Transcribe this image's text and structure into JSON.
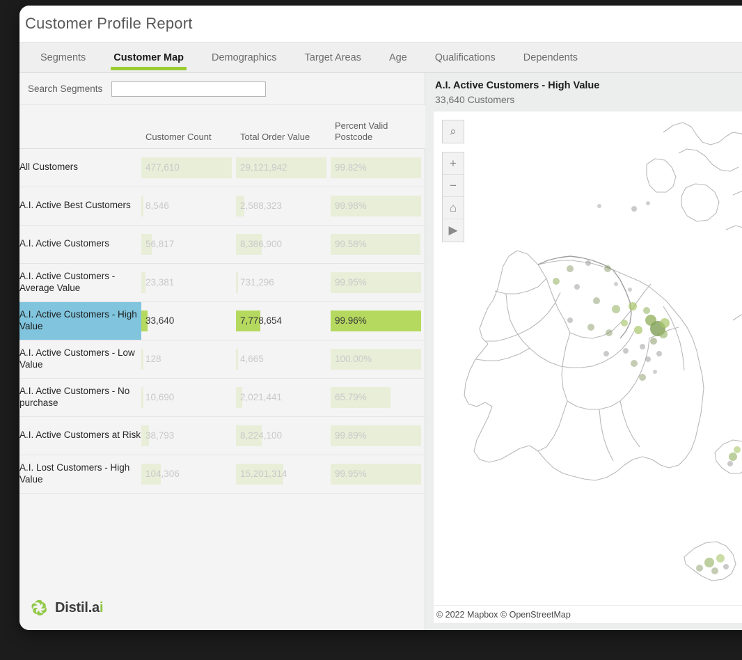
{
  "window": {
    "title": "Customer Profile Report",
    "background_color": "#1c1c1c",
    "card_color": "#f4f4f4"
  },
  "tabs": [
    {
      "label": "Segments",
      "active": false
    },
    {
      "label": "Customer Map",
      "active": true
    },
    {
      "label": "Demographics",
      "active": false
    },
    {
      "label": "Target Areas",
      "active": false
    },
    {
      "label": "Age",
      "active": false
    },
    {
      "label": "Qualifications",
      "active": false
    },
    {
      "label": "Dependents",
      "active": false
    }
  ],
  "search": {
    "label": "Search Segments",
    "value": "",
    "placeholder": ""
  },
  "table": {
    "columns": [
      "",
      "Customer Count",
      "Total Order Value",
      "Percent Valid Postcode"
    ],
    "rows": [
      {
        "name": "All Customers",
        "customer_count": "477,610",
        "total_order_value": "29,121,942",
        "percent_valid_postcode": "99.82%",
        "count_pct": 100,
        "value_pct": 100,
        "postcode_pct": 99.82,
        "selected": false
      },
      {
        "name": "A.I. Active Best Customers",
        "customer_count": "8,546",
        "total_order_value": "2,588,323",
        "percent_valid_postcode": "99.98%",
        "count_pct": 1.8,
        "value_pct": 8.9,
        "postcode_pct": 99.98,
        "selected": false
      },
      {
        "name": "A.I. Active Customers",
        "customer_count": "56,817",
        "total_order_value": "8,386,900",
        "percent_valid_postcode": "99.58%",
        "count_pct": 11.9,
        "value_pct": 28.8,
        "postcode_pct": 99.58,
        "selected": false
      },
      {
        "name": "A.I. Active Customers - Average Value",
        "customer_count": "23,381",
        "total_order_value": "731,296",
        "percent_valid_postcode": "99.95%",
        "count_pct": 4.9,
        "value_pct": 2.5,
        "postcode_pct": 99.95,
        "selected": false
      },
      {
        "name": "A.I. Active Customers - High Value",
        "customer_count": "33,640",
        "total_order_value": "7,778,654",
        "percent_valid_postcode": "99.96%",
        "count_pct": 7.0,
        "value_pct": 26.7,
        "postcode_pct": 99.96,
        "selected": true
      },
      {
        "name": "A.I. Active Customers - Low Value",
        "customer_count": "128",
        "total_order_value": "4,665",
        "percent_valid_postcode": "100.00%",
        "count_pct": 0.8,
        "value_pct": 0.8,
        "postcode_pct": 100,
        "selected": false
      },
      {
        "name": "A.I. Active Customers - No purchase",
        "customer_count": "10,690",
        "total_order_value": "2,021,441",
        "percent_valid_postcode": "65.79%",
        "count_pct": 2.2,
        "value_pct": 6.9,
        "postcode_pct": 65.79,
        "selected": false
      },
      {
        "name": "A.I. Active Customers at Risk",
        "customer_count": "38,793",
        "total_order_value": "8,224,100",
        "percent_valid_postcode": "99.89%",
        "count_pct": 8.1,
        "value_pct": 28.2,
        "postcode_pct": 99.89,
        "selected": false
      },
      {
        "name": "A.I. Lost Customers - High Value",
        "customer_count": "104,306",
        "total_order_value": "15,201,314",
        "percent_valid_postcode": "99.95%",
        "count_pct": 21.8,
        "value_pct": 52.2,
        "postcode_pct": 99.95,
        "selected": false
      }
    ]
  },
  "map": {
    "title": "A.I. Active Customers - High Value",
    "subtitle": "33,640 Customers",
    "attribution": "© 2022 Mapbox  © OpenStreetMap",
    "controls": [
      {
        "name": "search-icon",
        "glyph": "⌕"
      },
      {
        "name": "zoom-in-icon",
        "glyph": "+"
      },
      {
        "name": "zoom-out-icon",
        "glyph": "−"
      },
      {
        "name": "home-icon",
        "glyph": "⌂"
      },
      {
        "name": "compass-icon",
        "glyph": "▶"
      }
    ]
  },
  "logo": {
    "name_main": "Distil.a",
    "name_accent": "i",
    "mark_color": "#8cc63f"
  },
  "colors": {
    "accent_green": "#9ccc34",
    "bar_pale": "#e9eed8",
    "bar_bright": "#b5d95f",
    "selected_blue": "#80c4dd"
  }
}
